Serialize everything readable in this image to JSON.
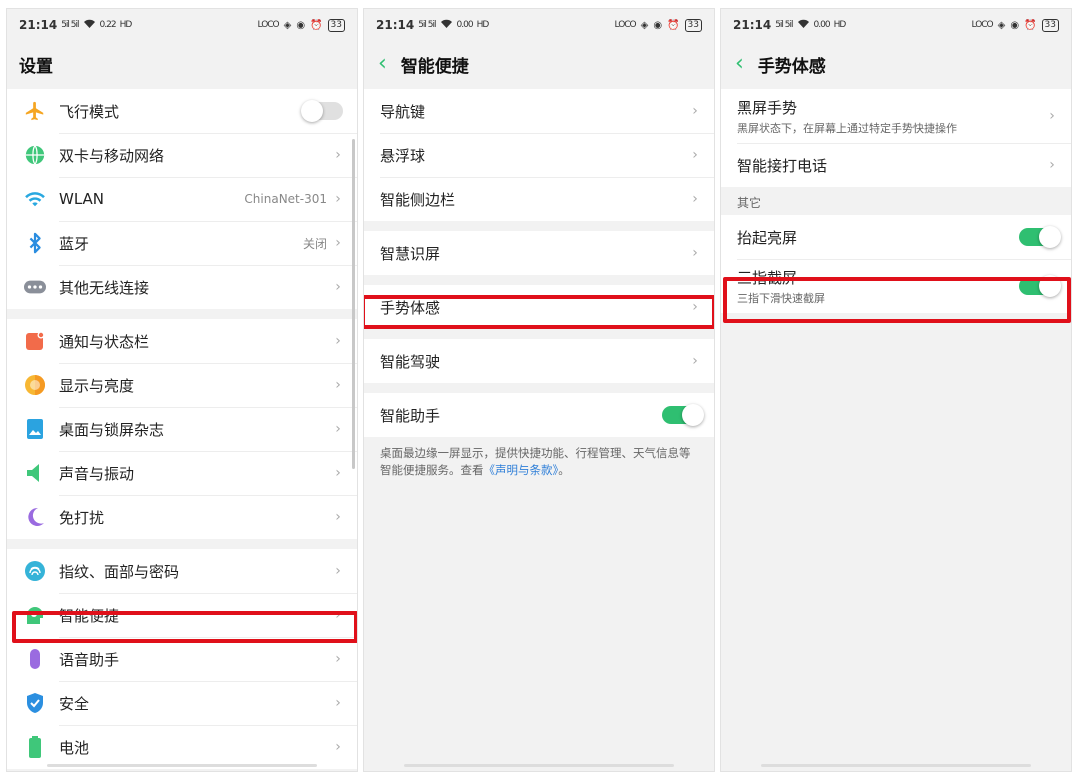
{
  "status": {
    "time": "21:14",
    "signal": "5il 5il",
    "speed1": {
      "p1": "0.22",
      "p2": "0.00",
      "p3": "0.00"
    },
    "speed_unit": "KB/S",
    "hd": "HD",
    "loc": "LOCO",
    "battery": "33"
  },
  "panel1": {
    "title": "设置",
    "group1": [
      {
        "label": "飞行模式",
        "icon": "airplane-icon",
        "toggle": "off"
      },
      {
        "label": "双卡与移动网络",
        "icon": "globe-icon"
      },
      {
        "label": "WLAN",
        "icon": "wifi-icon",
        "value": "ChinaNet-301"
      },
      {
        "label": "蓝牙",
        "icon": "bluetooth-icon",
        "value": "关闭"
      },
      {
        "label": "其他无线连接",
        "icon": "more-icon"
      }
    ],
    "group2": [
      {
        "label": "通知与状态栏",
        "icon": "notification-icon"
      },
      {
        "label": "显示与亮度",
        "icon": "brightness-icon"
      },
      {
        "label": "桌面与锁屏杂志",
        "icon": "wallpaper-icon"
      },
      {
        "label": "声音与振动",
        "icon": "sound-icon"
      },
      {
        "label": "免打扰",
        "icon": "moon-icon"
      }
    ],
    "group3": [
      {
        "label": "指纹、面部与密码",
        "icon": "fingerprint-icon"
      },
      {
        "label": "智能便捷",
        "icon": "smart-icon"
      },
      {
        "label": "语音助手",
        "icon": "microphone-icon"
      },
      {
        "label": "安全",
        "icon": "shield-icon"
      },
      {
        "label": "电池",
        "icon": "battery-icon"
      }
    ]
  },
  "panel2": {
    "title": "智能便捷",
    "group1": [
      "导航键",
      "悬浮球",
      "智能侧边栏"
    ],
    "group2": [
      "智慧识屏"
    ],
    "group3": [
      "手势体感"
    ],
    "group4": [
      "智能驾驶"
    ],
    "assistant_label": "智能助手",
    "assistant_toggle": "on",
    "desc_text": "桌面最边缘一屏显示，提供快捷功能、行程管理、天气信息等智能便捷服务。查看",
    "desc_link": "《声明与条款》",
    "desc_end": "。"
  },
  "panel3": {
    "title": "手势体感",
    "black_screen_label": "黑屏手势",
    "black_screen_sub": "黑屏状态下，在屏幕上通过特定手势快捷操作",
    "smart_call_label": "智能接打电话",
    "section_other": "其它",
    "raise_label": "抬起亮屏",
    "raise_toggle": "on",
    "three_finger_label": "三指截屏",
    "three_finger_sub": "三指下滑快速截屏",
    "three_finger_toggle": "on"
  },
  "colors": {
    "accent": "#2fbf71",
    "highlight": "#e0101a",
    "link": "#2f7fd8"
  }
}
